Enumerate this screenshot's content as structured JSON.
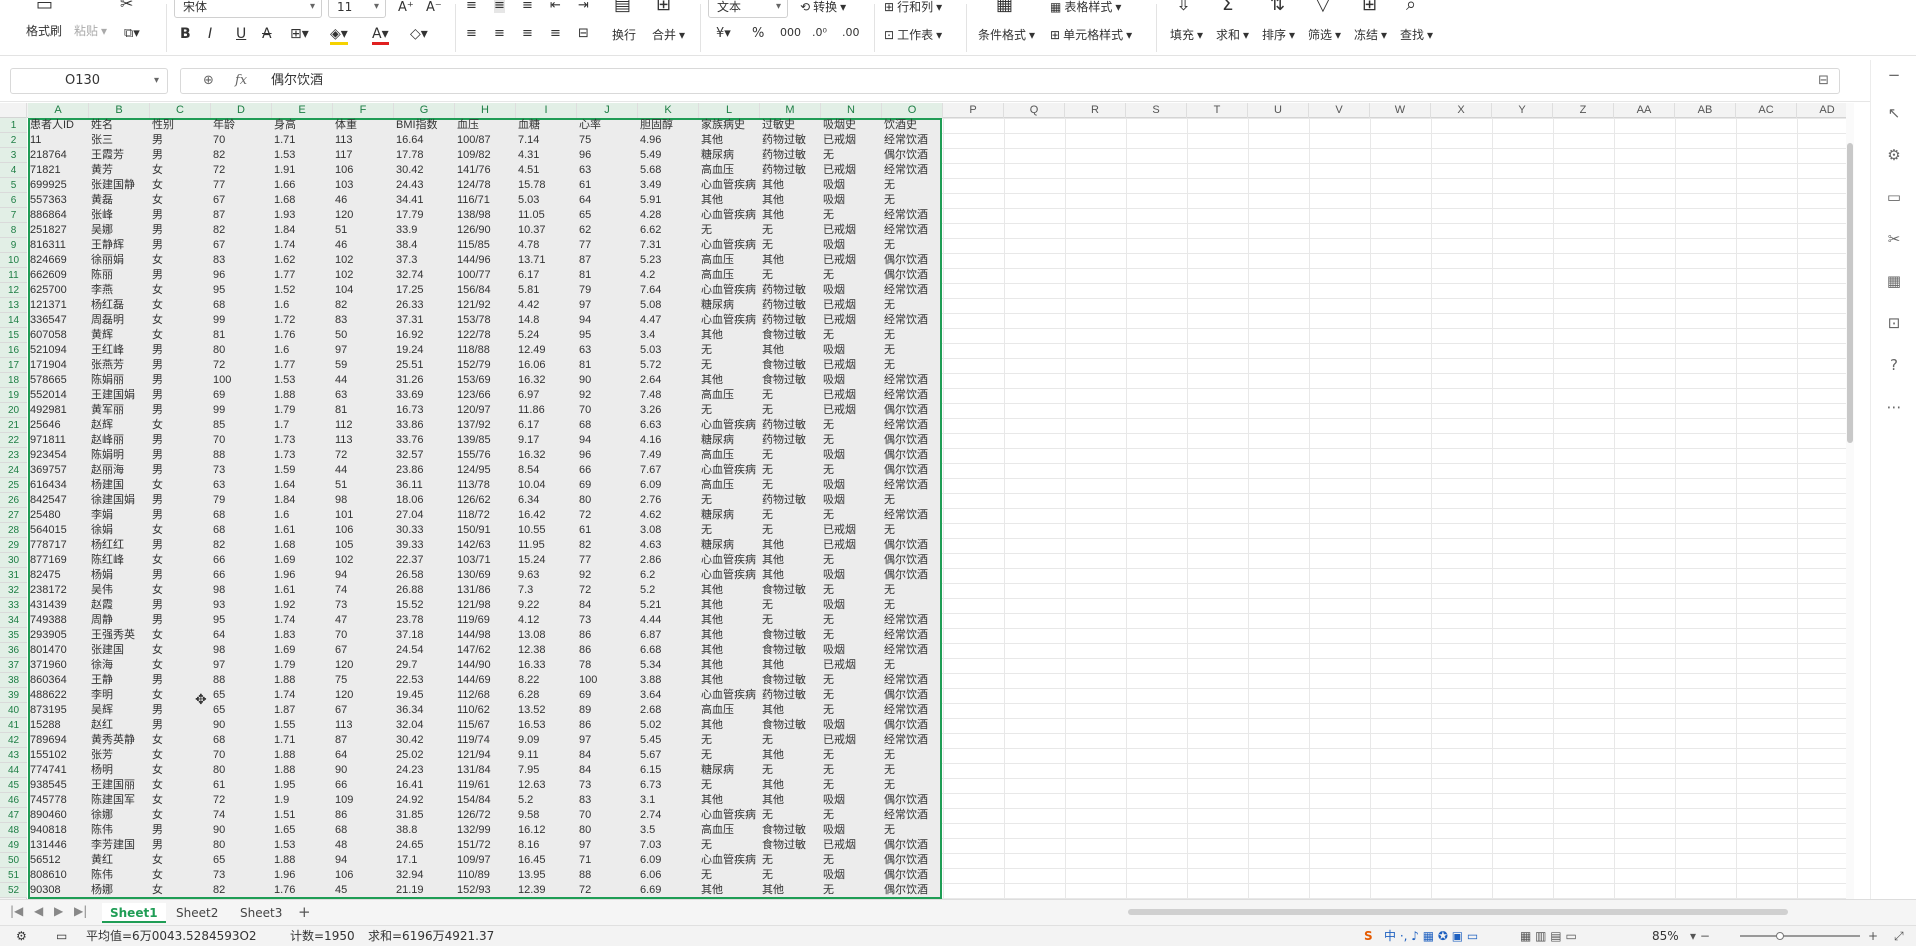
{
  "ribbon": {
    "format_painter": "格式刷",
    "paste": "粘贴",
    "font_name": "宋体",
    "font_size": "11",
    "wrap": "换行",
    "merge": "合并",
    "number_format": "文本",
    "convert": "转换",
    "row_col": "行和列",
    "worksheet": "工作表",
    "cond_format": "条件格式",
    "table_style": "表格样式",
    "cell_style": "单元格样式",
    "fill": "填充",
    "sum": "求和",
    "sort": "排序",
    "filter": "筛选",
    "freeze": "冻结",
    "find": "查找"
  },
  "formula_bar": {
    "cell_ref": "O130",
    "fx": "fx",
    "content": "偶尔饮酒"
  },
  "columns": [
    "A",
    "B",
    "C",
    "D",
    "E",
    "F",
    "G",
    "H",
    "I",
    "J",
    "K",
    "L",
    "M",
    "N",
    "O",
    "P",
    "Q",
    "R",
    "S",
    "T",
    "U",
    "V",
    "W",
    "X",
    "Y",
    "Z",
    "AA",
    "AB",
    "AC",
    "AD"
  ],
  "headers": [
    "患者人ID",
    "姓名",
    "性别",
    "年龄",
    "身高",
    "体重",
    "BMI指数",
    "血压",
    "血糖",
    "心率",
    "胆固醇",
    "家族病史",
    "过敏史",
    "吸烟史",
    "饮酒史"
  ],
  "rows": [
    [
      "11",
      "张三",
      "男",
      "70",
      "1.71",
      "113",
      "16.64",
      "100/87",
      "7.14",
      "75",
      "4.96",
      "其他",
      "药物过敏",
      "已戒烟",
      "经常饮酒"
    ],
    [
      "218764",
      "王霞芳",
      "男",
      "82",
      "1.53",
      "117",
      "17.78",
      "109/82",
      "4.31",
      "96",
      "5.49",
      "糖尿病",
      "药物过敏",
      "无",
      "偶尔饮酒"
    ],
    [
      "71821",
      "黄芳",
      "女",
      "72",
      "1.91",
      "106",
      "30.42",
      "141/76",
      "4.51",
      "63",
      "5.68",
      "高血压",
      "药物过敏",
      "已戒烟",
      "经常饮酒"
    ],
    [
      "699925",
      "张建国静",
      "女",
      "77",
      "1.66",
      "103",
      "24.43",
      "124/78",
      "15.78",
      "61",
      "3.49",
      "心血管疾病",
      "其他",
      "吸烟",
      "无"
    ],
    [
      "557363",
      "黄磊",
      "女",
      "67",
      "1.68",
      "46",
      "34.41",
      "116/71",
      "5.03",
      "64",
      "5.91",
      "其他",
      "其他",
      "吸烟",
      "无"
    ],
    [
      "886864",
      "张峰",
      "男",
      "87",
      "1.93",
      "120",
      "17.79",
      "138/98",
      "11.05",
      "65",
      "4.28",
      "心血管疾病",
      "其他",
      "无",
      "经常饮酒"
    ],
    [
      "251827",
      "吴娜",
      "男",
      "82",
      "1.84",
      "51",
      "33.9",
      "126/90",
      "10.37",
      "62",
      "6.62",
      "无",
      "无",
      "已戒烟",
      "经常饮酒"
    ],
    [
      "816311",
      "王静辉",
      "男",
      "67",
      "1.74",
      "46",
      "38.4",
      "115/85",
      "4.78",
      "77",
      "7.31",
      "心血管疾病",
      "无",
      "吸烟",
      "无"
    ],
    [
      "824669",
      "徐丽娟",
      "女",
      "83",
      "1.62",
      "102",
      "37.3",
      "144/96",
      "13.71",
      "87",
      "5.23",
      "高血压",
      "其他",
      "已戒烟",
      "偶尔饮酒"
    ],
    [
      "662609",
      "陈丽",
      "男",
      "96",
      "1.77",
      "102",
      "32.74",
      "100/77",
      "6.17",
      "81",
      "4.2",
      "高血压",
      "无",
      "无",
      "偶尔饮酒"
    ],
    [
      "625700",
      "李燕",
      "女",
      "95",
      "1.52",
      "104",
      "17.25",
      "156/84",
      "5.81",
      "79",
      "7.64",
      "心血管疾病",
      "药物过敏",
      "吸烟",
      "经常饮酒"
    ],
    [
      "121371",
      "杨红磊",
      "女",
      "68",
      "1.6",
      "82",
      "26.33",
      "121/92",
      "4.42",
      "97",
      "5.08",
      "糖尿病",
      "药物过敏",
      "已戒烟",
      "无"
    ],
    [
      "336547",
      "周磊明",
      "女",
      "99",
      "1.72",
      "83",
      "37.31",
      "153/78",
      "14.8",
      "94",
      "4.47",
      "心血管疾病",
      "药物过敏",
      "已戒烟",
      "经常饮酒"
    ],
    [
      "607058",
      "黄辉",
      "女",
      "81",
      "1.76",
      "50",
      "16.92",
      "122/78",
      "5.24",
      "95",
      "3.4",
      "其他",
      "食物过敏",
      "无",
      "无"
    ],
    [
      "521094",
      "王红峰",
      "男",
      "80",
      "1.6",
      "97",
      "19.24",
      "118/88",
      "12.49",
      "63",
      "5.03",
      "无",
      "其他",
      "吸烟",
      "无"
    ],
    [
      "171904",
      "张燕芳",
      "男",
      "72",
      "1.77",
      "59",
      "25.51",
      "152/79",
      "16.06",
      "81",
      "5.72",
      "无",
      "食物过敏",
      "已戒烟",
      "无"
    ],
    [
      "578665",
      "陈娟丽",
      "男",
      "100",
      "1.53",
      "44",
      "31.26",
      "153/69",
      "16.32",
      "90",
      "2.64",
      "其他",
      "食物过敏",
      "吸烟",
      "经常饮酒"
    ],
    [
      "552014",
      "王建国娟",
      "男",
      "69",
      "1.88",
      "63",
      "33.69",
      "123/66",
      "6.97",
      "92",
      "7.48",
      "高血压",
      "无",
      "已戒烟",
      "经常饮酒"
    ],
    [
      "492981",
      "黄军丽",
      "男",
      "99",
      "1.79",
      "81",
      "16.73",
      "120/97",
      "11.86",
      "70",
      "3.26",
      "无",
      "无",
      "已戒烟",
      "偶尔饮酒"
    ],
    [
      "25646",
      "赵辉",
      "女",
      "85",
      "1.7",
      "112",
      "33.86",
      "137/92",
      "6.17",
      "68",
      "6.63",
      "心血管疾病",
      "药物过敏",
      "无",
      "经常饮酒"
    ],
    [
      "971811",
      "赵峰丽",
      "男",
      "70",
      "1.73",
      "113",
      "33.76",
      "139/85",
      "9.17",
      "94",
      "4.16",
      "糖尿病",
      "药物过敏",
      "无",
      "偶尔饮酒"
    ],
    [
      "923454",
      "陈娟明",
      "男",
      "88",
      "1.73",
      "72",
      "32.57",
      "155/76",
      "16.32",
      "96",
      "7.49",
      "高血压",
      "无",
      "吸烟",
      "偶尔饮酒"
    ],
    [
      "369757",
      "赵丽海",
      "男",
      "73",
      "1.59",
      "44",
      "23.86",
      "124/95",
      "8.54",
      "66",
      "7.67",
      "心血管疾病",
      "无",
      "无",
      "偶尔饮酒"
    ],
    [
      "616434",
      "杨建国",
      "女",
      "63",
      "1.64",
      "51",
      "36.11",
      "113/78",
      "10.04",
      "69",
      "6.09",
      "高血压",
      "无",
      "吸烟",
      "经常饮酒"
    ],
    [
      "842547",
      "徐建国娟",
      "男",
      "79",
      "1.84",
      "98",
      "18.06",
      "126/62",
      "6.34",
      "80",
      "2.76",
      "无",
      "药物过敏",
      "吸烟",
      "无"
    ],
    [
      "25480",
      "李娟",
      "男",
      "68",
      "1.6",
      "101",
      "27.04",
      "118/72",
      "16.42",
      "72",
      "4.62",
      "糖尿病",
      "无",
      "无",
      "经常饮酒"
    ],
    [
      "564015",
      "徐娟",
      "女",
      "68",
      "1.61",
      "106",
      "30.33",
      "150/91",
      "10.55",
      "61",
      "3.08",
      "无",
      "无",
      "已戒烟",
      "无"
    ],
    [
      "778717",
      "杨红红",
      "男",
      "82",
      "1.68",
      "105",
      "39.33",
      "142/63",
      "11.95",
      "82",
      "4.63",
      "糖尿病",
      "其他",
      "已戒烟",
      "偶尔饮酒"
    ],
    [
      "877169",
      "陈红峰",
      "女",
      "66",
      "1.69",
      "102",
      "22.37",
      "103/71",
      "15.24",
      "77",
      "2.86",
      "心血管疾病",
      "其他",
      "无",
      "偶尔饮酒"
    ],
    [
      "82475",
      "杨娟",
      "男",
      "66",
      "1.96",
      "94",
      "26.58",
      "130/69",
      "9.63",
      "92",
      "6.2",
      "心血管疾病",
      "其他",
      "吸烟",
      "偶尔饮酒"
    ],
    [
      "238172",
      "吴伟",
      "女",
      "98",
      "1.61",
      "74",
      "26.88",
      "131/86",
      "7.3",
      "72",
      "5.2",
      "其他",
      "食物过敏",
      "无",
      "无"
    ],
    [
      "431439",
      "赵霞",
      "男",
      "93",
      "1.92",
      "73",
      "15.52",
      "121/98",
      "9.22",
      "84",
      "5.21",
      "其他",
      "无",
      "吸烟",
      "无"
    ],
    [
      "749388",
      "周静",
      "男",
      "95",
      "1.74",
      "47",
      "23.78",
      "119/69",
      "4.12",
      "73",
      "4.44",
      "其他",
      "无",
      "无",
      "经常饮酒"
    ],
    [
      "293905",
      "王强秀英",
      "女",
      "64",
      "1.83",
      "70",
      "37.18",
      "144/98",
      "13.08",
      "86",
      "6.87",
      "其他",
      "食物过敏",
      "无",
      "经常饮酒"
    ],
    [
      "801470",
      "张建国",
      "女",
      "98",
      "1.69",
      "67",
      "24.54",
      "147/62",
      "12.38",
      "86",
      "6.68",
      "其他",
      "食物过敏",
      "吸烟",
      "经常饮酒"
    ],
    [
      "371960",
      "徐海",
      "女",
      "97",
      "1.79",
      "120",
      "29.7",
      "144/90",
      "16.33",
      "78",
      "5.34",
      "其他",
      "其他",
      "已戒烟",
      "无"
    ],
    [
      "860364",
      "王静",
      "男",
      "88",
      "1.88",
      "75",
      "22.53",
      "144/69",
      "8.22",
      "100",
      "3.88",
      "其他",
      "食物过敏",
      "无",
      "经常饮酒"
    ],
    [
      "488622",
      "李明",
      "女",
      "65",
      "1.74",
      "120",
      "19.45",
      "112/68",
      "6.28",
      "69",
      "3.64",
      "心血管疾病",
      "药物过敏",
      "无",
      "偶尔饮酒"
    ],
    [
      "873195",
      "吴辉",
      "男",
      "65",
      "1.87",
      "67",
      "36.34",
      "110/62",
      "13.52",
      "89",
      "2.68",
      "高血压",
      "其他",
      "无",
      "经常饮酒"
    ],
    [
      "15288",
      "赵红",
      "男",
      "90",
      "1.55",
      "113",
      "32.04",
      "115/67",
      "16.53",
      "86",
      "5.02",
      "其他",
      "食物过敏",
      "吸烟",
      "偶尔饮酒"
    ],
    [
      "789694",
      "黄秀英静",
      "女",
      "68",
      "1.71",
      "87",
      "30.42",
      "119/74",
      "9.09",
      "97",
      "5.45",
      "无",
      "无",
      "已戒烟",
      "经常饮酒"
    ],
    [
      "155102",
      "张芳",
      "女",
      "70",
      "1.88",
      "64",
      "25.02",
      "121/94",
      "9.11",
      "84",
      "5.67",
      "无",
      "其他",
      "无",
      "无"
    ],
    [
      "774741",
      "杨明",
      "女",
      "80",
      "1.88",
      "90",
      "24.23",
      "131/84",
      "7.95",
      "84",
      "6.15",
      "糖尿病",
      "无",
      "无",
      "无"
    ],
    [
      "938545",
      "王建国丽",
      "女",
      "61",
      "1.95",
      "66",
      "16.41",
      "119/61",
      "12.63",
      "73",
      "6.73",
      "无",
      "其他",
      "无",
      "无"
    ],
    [
      "745778",
      "陈建国军",
      "女",
      "72",
      "1.9",
      "109",
      "24.92",
      "154/84",
      "5.2",
      "83",
      "3.1",
      "其他",
      "其他",
      "吸烟",
      "偶尔饮酒"
    ],
    [
      "890460",
      "徐娜",
      "女",
      "74",
      "1.51",
      "86",
      "31.85",
      "126/72",
      "9.58",
      "70",
      "2.74",
      "心血管疾病",
      "无",
      "无",
      "经常饮酒"
    ],
    [
      "940818",
      "陈伟",
      "男",
      "90",
      "1.65",
      "68",
      "38.8",
      "132/99",
      "16.12",
      "80",
      "3.5",
      "高血压",
      "食物过敏",
      "吸烟",
      "无"
    ],
    [
      "131446",
      "李芳建国",
      "男",
      "80",
      "1.53",
      "48",
      "24.65",
      "151/72",
      "8.16",
      "97",
      "7.03",
      "无",
      "食物过敏",
      "已戒烟",
      "偶尔饮酒"
    ],
    [
      "56512",
      "黄红",
      "女",
      "65",
      "1.88",
      "94",
      "17.1",
      "109/97",
      "16.45",
      "71",
      "6.09",
      "心血管疾病",
      "无",
      "无",
      "偶尔饮酒"
    ],
    [
      "808610",
      "陈伟",
      "女",
      "73",
      "1.96",
      "106",
      "32.94",
      "110/89",
      "13.95",
      "88",
      "6.06",
      "无",
      "无",
      "吸烟",
      "偶尔饮酒"
    ],
    [
      "90308",
      "杨娜",
      "女",
      "82",
      "1.76",
      "45",
      "21.19",
      "152/93",
      "12.39",
      "72",
      "6.69",
      "其他",
      "其他",
      "无",
      "偶尔饮酒"
    ]
  ],
  "sheets": [
    "Sheet1",
    "Sheet2",
    "Sheet3"
  ],
  "status": {
    "avg": "平均值=6万0043.5284593O2",
    "count": "计数=1950",
    "sum": "求和=6196万4921.37",
    "zoom": "85%"
  }
}
